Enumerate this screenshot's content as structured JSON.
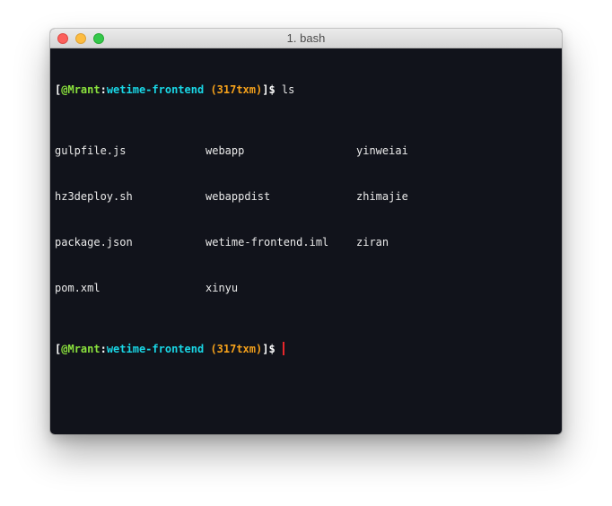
{
  "window": {
    "title": "1. bash"
  },
  "prompt": {
    "open_bracket": "[",
    "at": "@",
    "user": "Mrant",
    "colon": ":",
    "cwd": "wetime-frontend",
    "branch": "(317txm)",
    "close": "]$",
    "colors": {
      "user": "#8be23d",
      "cwd": "#19d7e6",
      "branch": "#f5a11b",
      "cursor": "#e8262a"
    }
  },
  "command": "ls",
  "ls_output": {
    "rows": [
      [
        "gulpfile.js",
        "webapp",
        "yinweiai"
      ],
      [
        "hz3deploy.sh",
        "webappdist",
        "zhimajie"
      ],
      [
        "package.json",
        "wetime-frontend.iml",
        "ziran"
      ],
      [
        "pom.xml",
        "xinyu",
        ""
      ]
    ]
  }
}
